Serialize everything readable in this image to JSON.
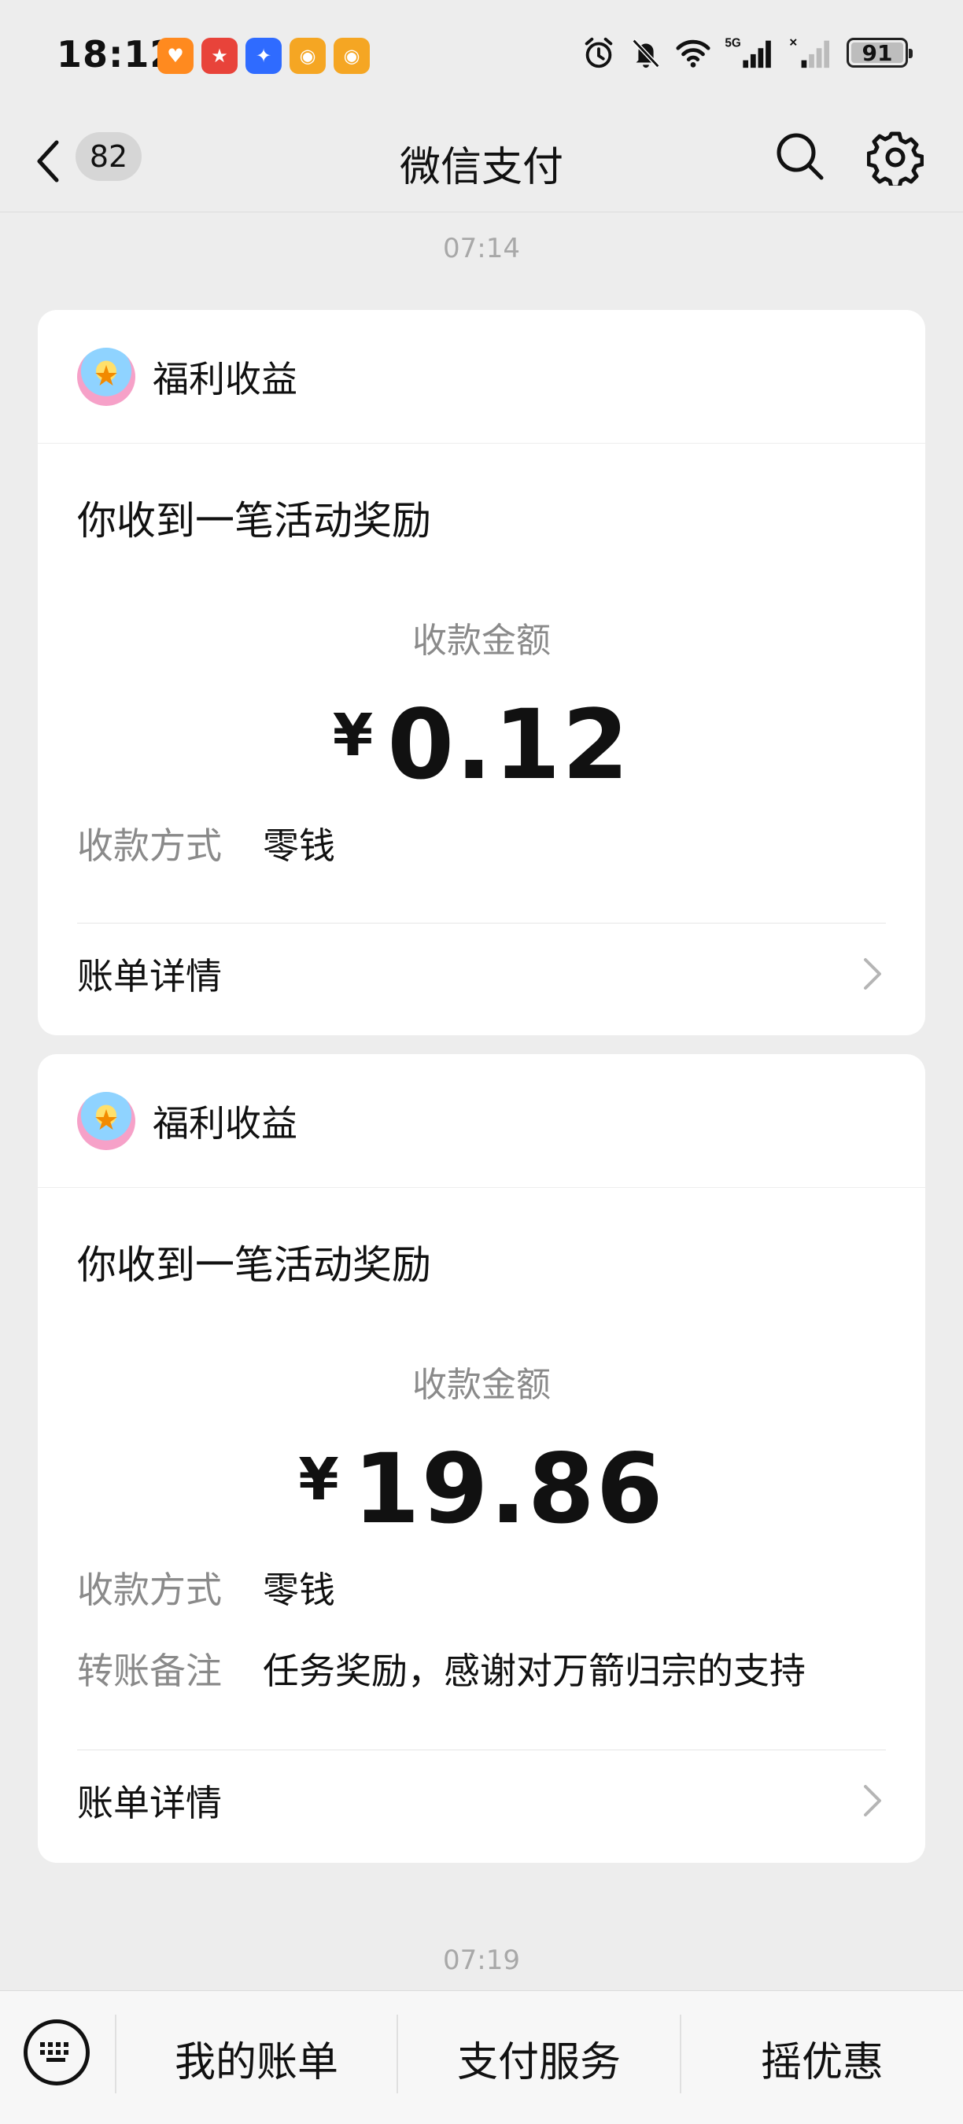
{
  "status_bar": {
    "time": "18:12",
    "battery_level": "91",
    "network_label": "5G",
    "app_icons": [
      "heart-app-icon",
      "game-app-icon",
      "blue-app-icon",
      "weibo-app-icon",
      "weibo-app-icon"
    ]
  },
  "nav": {
    "unread_count": "82",
    "title": "微信支付"
  },
  "timestamps": {
    "first": "07:14",
    "last": "07:19"
  },
  "cards": [
    {
      "sender": "福利收益",
      "description": "你收到一笔活动奖励",
      "amount_label": "收款金额",
      "currency": "¥",
      "amount": "0.12",
      "method_key": "收款方式",
      "method_value": "零钱",
      "bill_detail": "账单详情"
    },
    {
      "sender": "福利收益",
      "description": "你收到一笔活动奖励",
      "amount_label": "收款金额",
      "currency": "¥",
      "amount": "19.86",
      "method_key": "收款方式",
      "method_value": "零钱",
      "note_key": "转账备注",
      "note_value": "任务奖励，感谢对万箭归宗的支持",
      "bill_detail": "账单详情"
    }
  ],
  "bottom_menu": {
    "items": [
      "我的账单",
      "支付服务",
      "摇优惠"
    ]
  },
  "colors": {
    "background": "#ededed",
    "card": "#ffffff",
    "muted_text": "#8a8a8a"
  }
}
